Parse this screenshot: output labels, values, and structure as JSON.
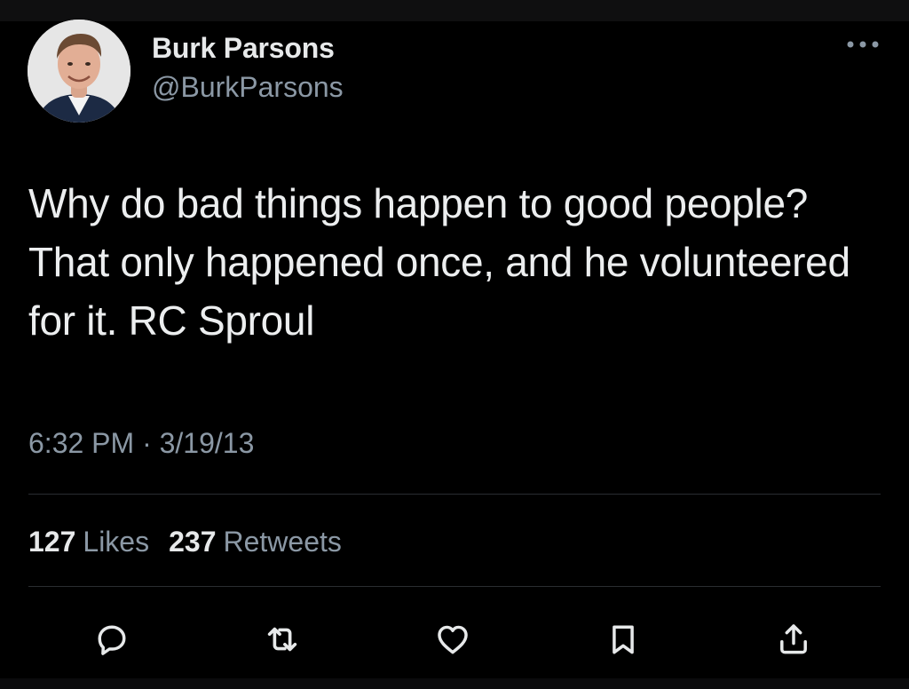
{
  "author": {
    "display_name": "Burk Parsons",
    "handle": "@BurkParsons"
  },
  "tweet": {
    "text": "Why do bad things happen to good people? That only happened once, and he volunteered for it. RC Sproul",
    "timestamp": "6:32 PM · 3/19/13"
  },
  "stats": {
    "likes_count": "127",
    "likes_label": "Likes",
    "retweets_count": "237",
    "retweets_label": "Retweets"
  },
  "icons": {
    "more": "more-options-icon",
    "reply": "reply-icon",
    "retweet": "retweet-icon",
    "like": "like-icon",
    "bookmark": "bookmark-icon",
    "share": "share-icon"
  },
  "colors": {
    "background": "#000000",
    "primary_text": "#e7e9ea",
    "secondary_text": "#8b98a5",
    "divider": "#2a2d31"
  }
}
